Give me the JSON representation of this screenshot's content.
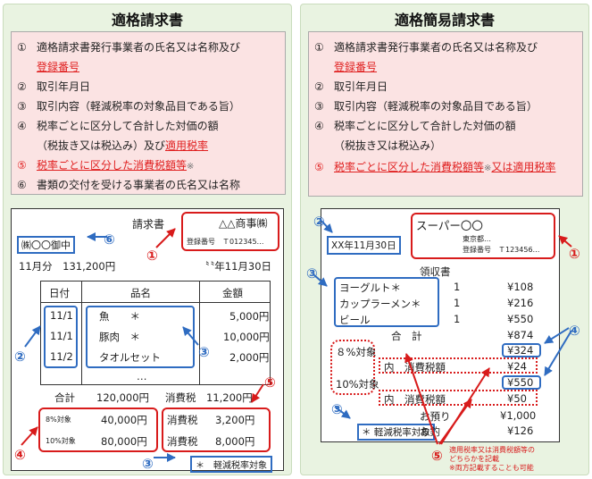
{
  "left": {
    "title": "適格請求書",
    "items": [
      {
        "num": "①",
        "text": "適格請求書発行事業者の氏名又は名称及び"
      },
      {
        "num": "",
        "text": "登録番号"
      },
      {
        "num": "②",
        "text": "取引年月日"
      },
      {
        "num": "③",
        "text": "取引内容（軽減税率の対象品目である旨）"
      },
      {
        "num": "④",
        "text": "税率ごとに区分して合計した対価の額"
      },
      {
        "num": "",
        "text": "（税抜き又は税込み）及び",
        "red": "適用税率"
      },
      {
        "num": "⑤",
        "text": "税率ごとに区分した消費税額等",
        "suffix": "※"
      },
      {
        "num": "⑥",
        "text": "書類の交付を受ける事業者の氏名又は名称"
      }
    ],
    "invoice": {
      "title": "請求書",
      "customer": "㈱〇〇御中",
      "seller": "△△商事㈱",
      "reg_no": "登録番号　Ｔ012345…",
      "period": "11月分　131,200円",
      "date": "〝〝年11月30日",
      "headers": [
        "日付",
        "品名",
        "金額"
      ],
      "rows": [
        {
          "date": "11/1",
          "item": "魚　　＊",
          "amount": "5,000円"
        },
        {
          "date": "11/1",
          "item": "豚肉　＊",
          "amount": "10,000円"
        },
        {
          "date": "11/2",
          "item": "タオルセット",
          "amount": "2,000円"
        },
        {
          "date": "",
          "item": "…",
          "amount": ""
        }
      ],
      "total_label": "合計",
      "total_value": "120,000円",
      "tax_label": "消費税",
      "tax_value": "11,200円",
      "rate8_label": "8%対象",
      "rate8_value": "40,000円",
      "rate10_label": "10%対象",
      "rate10_value": "80,000円",
      "tax8_label": "消費税",
      "tax8_value": "3,200円",
      "tax10_label": "消費税",
      "tax10_value": "8,000円",
      "note": "＊　軽減税率対象"
    },
    "markers": [
      "①",
      "②",
      "③",
      "④",
      "⑤",
      "⑥",
      "③"
    ]
  },
  "right": {
    "title": "適格簡易請求書",
    "items": [
      {
        "num": "①",
        "text": "適格請求書発行事業者の氏名又は名称及び"
      },
      {
        "num": "",
        "text": "登録番号"
      },
      {
        "num": "②",
        "text": "取引年月日"
      },
      {
        "num": "③",
        "text": "取引内容（軽減税率の対象品目である旨）"
      },
      {
        "num": "④",
        "text": "税率ごとに区分して合計した対価の額"
      },
      {
        "num": "",
        "text": "（税抜き又は税込み）"
      },
      {
        "num": "⑤",
        "text": "税率ごとに区分した消費税額等",
        "mid": "※",
        "tail": "又は適用税率"
      }
    ],
    "receipt": {
      "store": "スーパー〇〇",
      "address": "東京都…",
      "reg_no": "登録番号　Ｔ123456…",
      "date": "XX年11月30日",
      "title": "領収書",
      "items": [
        {
          "name": "ヨーグルト＊",
          "qty": "1",
          "price": "¥108"
        },
        {
          "name": "カップラーメン＊",
          "qty": "1",
          "price": "¥216"
        },
        {
          "name": "ビール",
          "qty": "1",
          "price": "¥550"
        }
      ],
      "total_label": "合　計",
      "total_value": "¥874",
      "rate8_label": "８%対象",
      "rate8_value": "¥324",
      "tax8_label": "内　消費税額",
      "tax8_value": "¥24",
      "rate10_label": "10%対象",
      "rate10_value": "¥550",
      "tax10_label": "内　消費税額",
      "tax10_value": "¥50",
      "deposit_label": "お預り",
      "deposit_value": "¥1,000",
      "change_label": "お釣",
      "change_value": "¥126",
      "note": "＊ 軽減税率対象",
      "footnote1": "適用税率又は消費税額等の",
      "footnote2": "どちらかを記載",
      "footnote3": "※両方記載することも可能"
    },
    "markers": [
      "②",
      "①",
      "③",
      "④",
      "③",
      "⑤"
    ]
  }
}
